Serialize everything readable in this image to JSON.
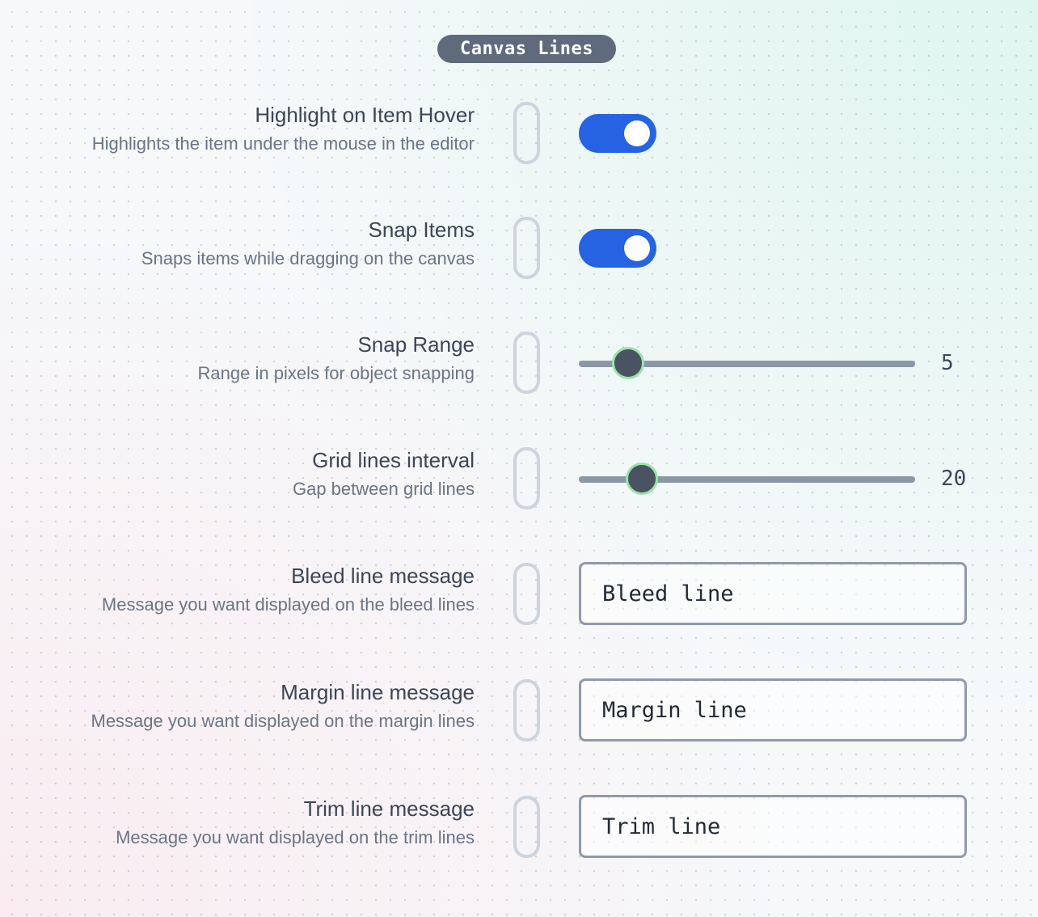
{
  "section": {
    "title": "Canvas Lines"
  },
  "settings": [
    {
      "title": "Highlight on Item Hover",
      "description": "Highlights the item under the mouse in the editor",
      "control": "toggle",
      "enabled": true
    },
    {
      "title": "Snap Items",
      "description": "Snaps items while dragging on the canvas",
      "control": "toggle",
      "enabled": true
    },
    {
      "title": "Snap Range",
      "description": "Range in pixels for object snapping",
      "control": "slider",
      "value": "5",
      "fraction": 0.145
    },
    {
      "title": "Grid lines interval",
      "description": "Gap between grid lines",
      "control": "slider",
      "value": "20",
      "fraction": 0.185
    },
    {
      "title": "Bleed line message",
      "description": "Message you want displayed on the bleed lines",
      "control": "text",
      "value": "Bleed line"
    },
    {
      "title": "Margin line message",
      "description": "Message you want displayed on the margin lines",
      "control": "text",
      "value": "Margin line"
    },
    {
      "title": "Trim line message",
      "description": "Message you want displayed on the trim lines",
      "control": "text",
      "value": "Trim line"
    }
  ],
  "colors": {
    "toggle_on": "#2563e3",
    "slider_thumb": "#4a5361",
    "slider_thumb_ring": "#9be3a8",
    "section_pill": "#5f6b7d"
  }
}
